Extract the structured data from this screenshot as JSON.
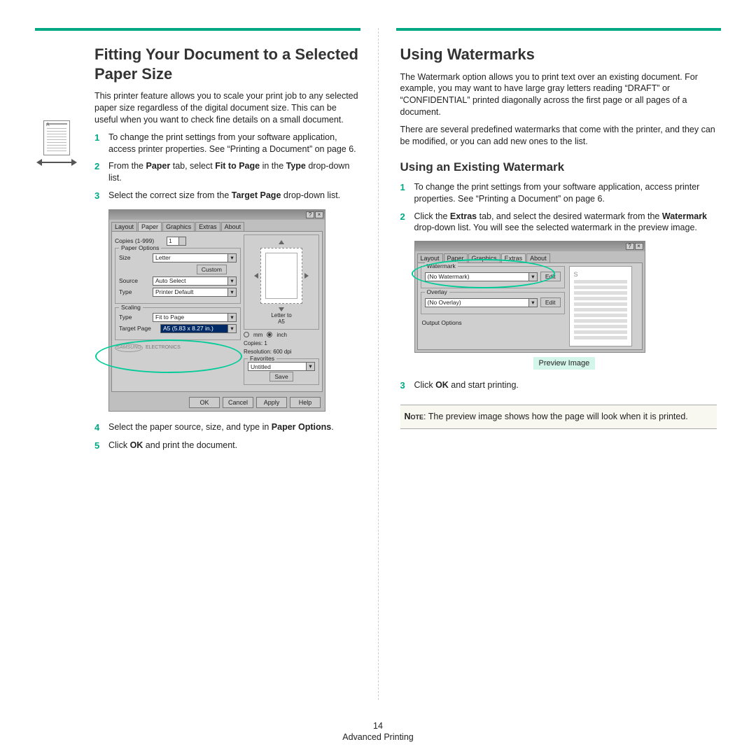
{
  "footer": {
    "pageNum": "14",
    "section": "Advanced Printing"
  },
  "left": {
    "heading": "Fitting Your Document to a Selected Paper Size",
    "intro": "This printer feature allows you to scale your print job to any selected paper size regardless of the digital document size. This can be useful when you want to check fine details on a small document.",
    "steps": {
      "s1": "To change the print settings from your software application, access printer properties. See “Printing a Document” on page 6.",
      "s2a": "From the ",
      "s2b": "Paper",
      "s2c": " tab, select ",
      "s2d": "Fit to Page",
      "s2e": " in the ",
      "s2f": "Type",
      "s2g": " drop-down list.",
      "s3a": "Select the correct size from the ",
      "s3b": "Target Page",
      "s3c": " drop-down list.",
      "s4a": "Select the paper source, size, and type in ",
      "s4b": "Paper Options",
      "s4c": ".",
      "s5a": "Click ",
      "s5b": "OK",
      "s5c": " and print the document."
    },
    "dialog": {
      "tabs": [
        "Layout",
        "Paper",
        "Graphics",
        "Extras",
        "About"
      ],
      "copiesLabel": "Copies (1-999)",
      "copiesVal": "1",
      "paperOptions": "Paper Options",
      "sizeLabel": "Size",
      "sizeVal": "Letter",
      "customBtn": "Custom",
      "sourceLabel": "Source",
      "sourceVal": "Auto Select",
      "typeLabel": "Type",
      "typeVal": "Printer Default",
      "scaling": "Scaling",
      "scaleTypeLabel": "Type",
      "scaleTypeVal": "Fit to Page",
      "targetLabel": "Target Page",
      "targetVal": "A5 (5.83 x 8.27 in.)",
      "previewLabel": "Letter to\nA5",
      "mm": "mm",
      "inch": "inch",
      "copiesInfo": "Copies: 1",
      "resInfo": "Resolution: 600 dpi",
      "favorites": "Favorites",
      "favVal": "Untitled",
      "saveBtn": "Save",
      "brand": "SAMSUNG",
      "elec": "ELECTRONICS",
      "ok": "OK",
      "cancel": "Cancel",
      "apply": "Apply",
      "help": "Help"
    }
  },
  "right": {
    "heading": "Using Watermarks",
    "p1": "The Watermark option allows you to print text over an existing document. For example, you may want to have large gray letters reading “DRAFT” or “CONFIDENTIAL” printed diagonally across the first page or all pages of a document.",
    "p2": "There are several predefined watermarks that come with the printer, and they can be modified, or you can add new ones to the list.",
    "sub": "Using an Existing Watermark",
    "steps": {
      "s1": "To change the print settings from your software application, access printer properties. See “Printing a Document” on page 6.",
      "s2a": "Click the ",
      "s2b": "Extras",
      "s2c": " tab, and select the desired watermark from the ",
      "s2d": "Watermark",
      "s2e": " drop-down list. You will see the selected watermark in the preview image.",
      "s3a": "Click ",
      "s3b": "OK",
      "s3c": " and start printing."
    },
    "dialog": {
      "tabs": [
        "Layout",
        "Paper",
        "Graphics",
        "Extras",
        "About"
      ],
      "watermark": "Watermark",
      "wmVal": "(No Watermark)",
      "edit": "Edit",
      "overlay": "Overlay",
      "ovVal": "(No Overlay)",
      "outputOptions": "Output Options",
      "sLetter": "S"
    },
    "previewLabel": "Preview Image",
    "noteLabel": "Note",
    "noteText": ": The preview image shows how the page will look when it is printed."
  }
}
